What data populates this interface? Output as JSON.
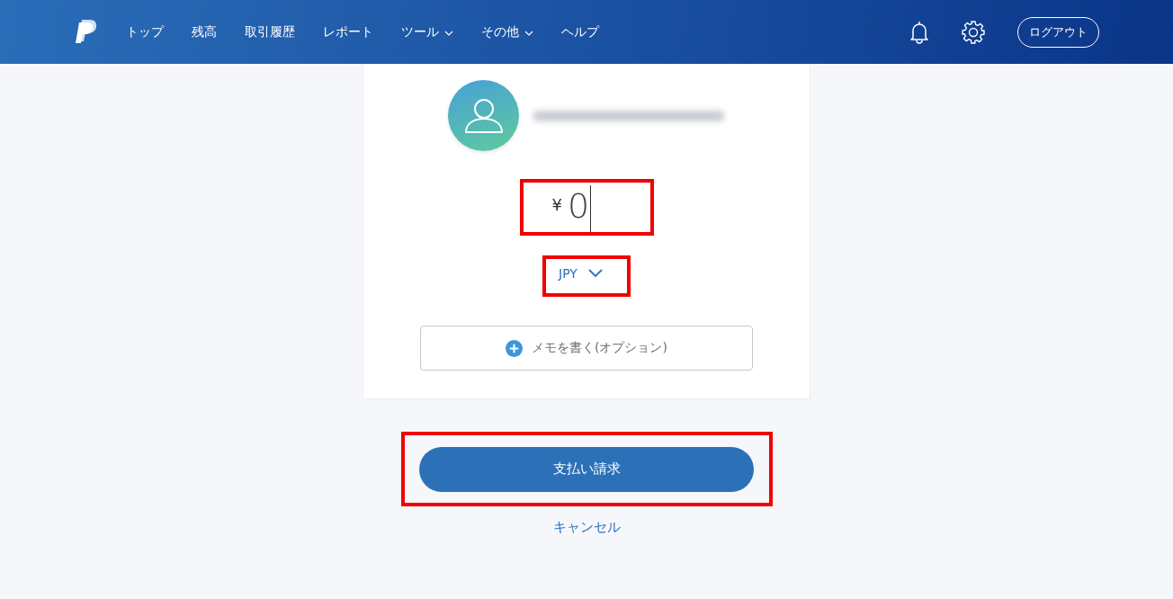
{
  "nav": {
    "items": [
      {
        "label": "トップ",
        "dropdown": false
      },
      {
        "label": "残高",
        "dropdown": false
      },
      {
        "label": "取引履歴",
        "dropdown": false
      },
      {
        "label": "レポート",
        "dropdown": false
      },
      {
        "label": "ツール",
        "dropdown": true
      },
      {
        "label": "その他",
        "dropdown": true
      },
      {
        "label": "ヘルプ",
        "dropdown": false
      }
    ],
    "logout": "ログアウト"
  },
  "recipient": {
    "email_redacted": true
  },
  "amount": {
    "currency_symbol": "¥",
    "value": "0",
    "highlighted": true
  },
  "currency": {
    "code": "JPY",
    "highlighted": true
  },
  "memo": {
    "label": "メモを書く(オプション)"
  },
  "submit": {
    "label": "支払い請求",
    "highlighted": true
  },
  "cancel": "キャンセル"
}
